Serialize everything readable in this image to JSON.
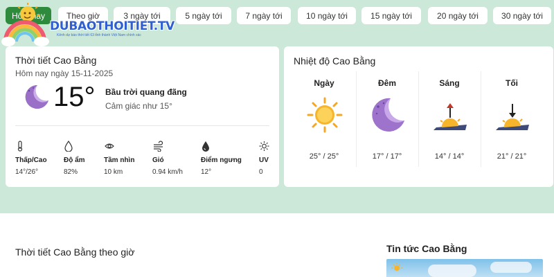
{
  "logo": {
    "brand": "DUBAOTHOITIET.TV",
    "tagline": "Kênh dự báo thời tiết 63 tỉnh thành Việt Nam chính xác"
  },
  "tabs": [
    {
      "label": "Hôm nay"
    },
    {
      "label": "Theo giờ"
    },
    {
      "label": "3 ngày tới"
    },
    {
      "label": "5 ngày tới"
    },
    {
      "label": "7 ngày tới"
    },
    {
      "label": "10 ngày tới"
    },
    {
      "label": "15 ngày tới"
    },
    {
      "label": "20 ngày tới"
    },
    {
      "label": "30 ngày tới"
    }
  ],
  "current": {
    "title": "Thời tiết Cao Bằng",
    "date": "Hôm nay ngày 15-11-2025",
    "temp": "15°",
    "description": "Bầu trời quang đãng",
    "feels_like": "Cảm giác như 15°",
    "icon": "moon-icon",
    "stats": [
      {
        "icon": "thermometer-icon",
        "label": "Thấp/Cao",
        "value": "14°/26°"
      },
      {
        "icon": "droplet-icon",
        "label": "Độ ẩm",
        "value": "82%"
      },
      {
        "icon": "eye-icon",
        "label": "Tầm nhìn",
        "value": "10 km"
      },
      {
        "icon": "wind-icon",
        "label": "Gió",
        "value": "0.94 km/h"
      },
      {
        "icon": "dewpoint-icon",
        "label": "Điểm ngưng",
        "value": "12°"
      },
      {
        "icon": "sun-uv-icon",
        "label": "UV",
        "value": "0"
      }
    ]
  },
  "temperature": {
    "title": "Nhiệt độ Cao Bằng",
    "periods": [
      {
        "name": "Ngày",
        "icon": "sun-icon",
        "temp": "25° / 25°"
      },
      {
        "name": "Đêm",
        "icon": "moon-icon",
        "temp": "17° / 17°"
      },
      {
        "name": "Sáng",
        "icon": "sunrise-icon",
        "temp": "14° / 14°"
      },
      {
        "name": "Tối",
        "icon": "sunset-icon",
        "temp": "21° / 21°"
      }
    ]
  },
  "hourly": {
    "title": "Thời tiết Cao Bằng theo giờ"
  },
  "news": {
    "title": "Tin tức Cao Bằng"
  },
  "colors": {
    "band": "#cce8d8",
    "active_tab": "#2e8b3e",
    "brand_text": "#2f5fd0"
  }
}
